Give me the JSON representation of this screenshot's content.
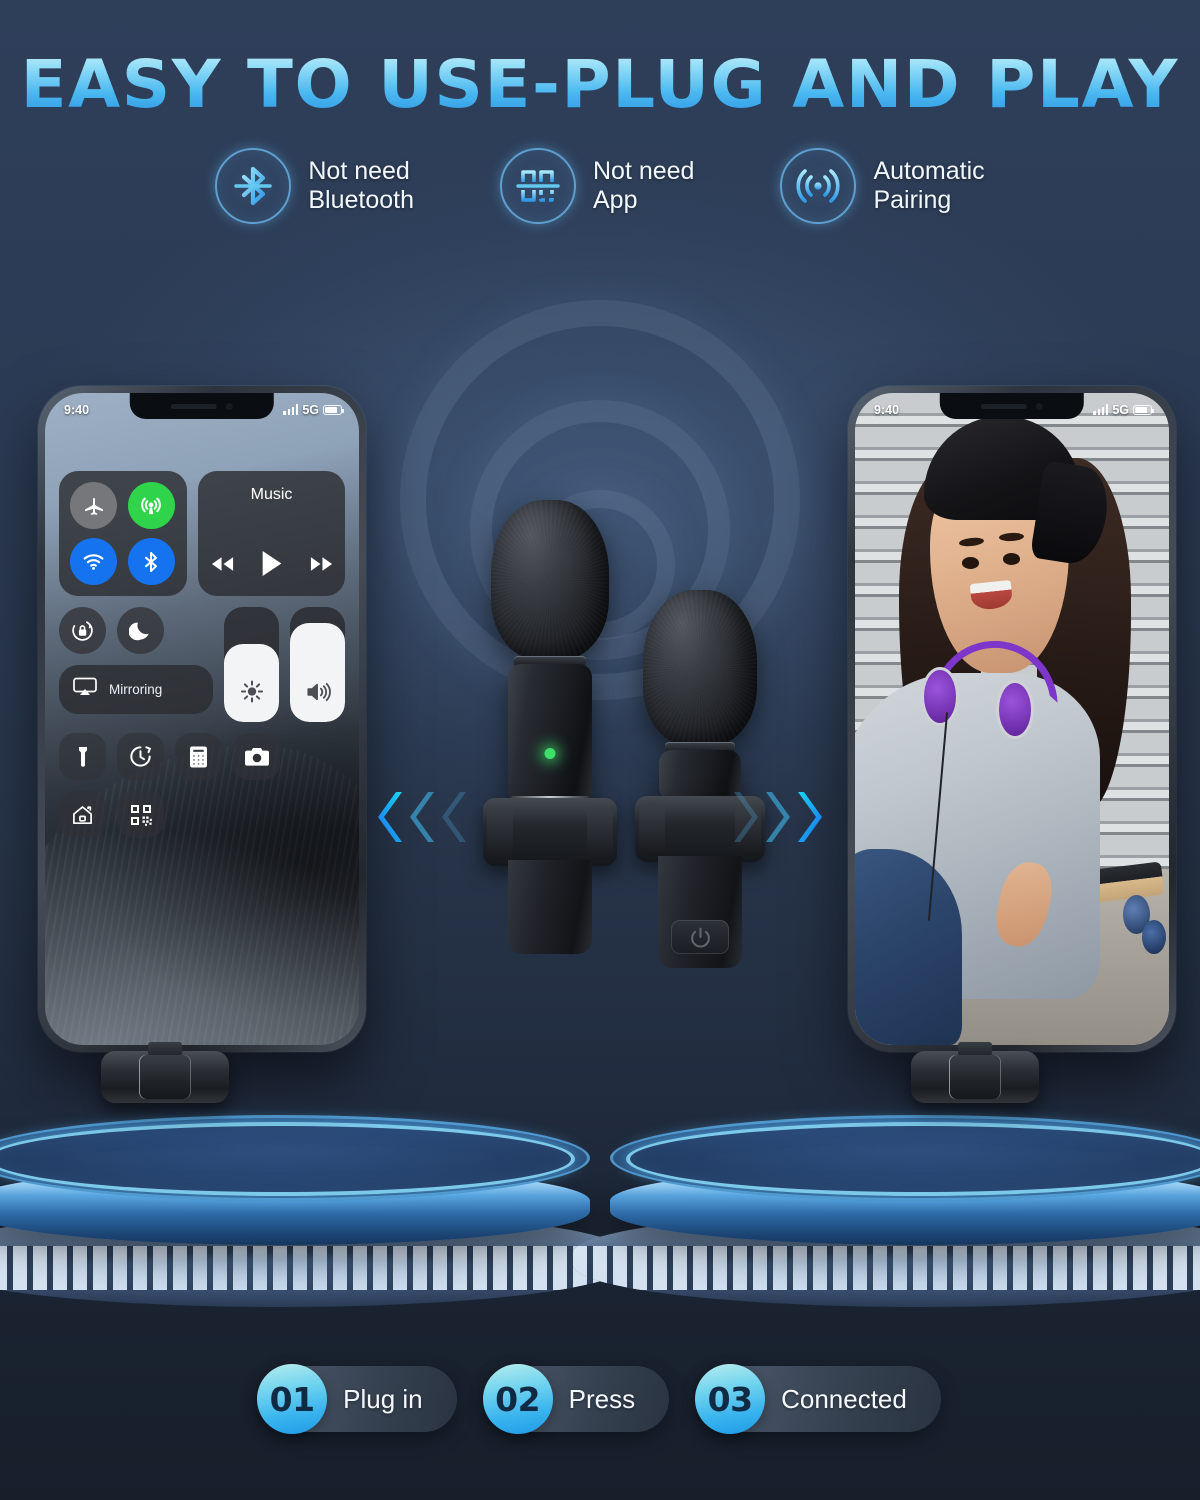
{
  "headline": "EASY TO USE-PLUG AND PLAY",
  "features": [
    {
      "icon": "bluetooth-disabled-icon",
      "label": "Not need\nBluetooth"
    },
    {
      "icon": "app-disabled-icon",
      "label": "Not need\nApp"
    },
    {
      "icon": "wireless-signal-icon",
      "label": "Automatic\nPairing"
    }
  ],
  "phones": {
    "left": {
      "name": "control-center-phone",
      "status": {
        "time": "9:40",
        "network": "5G"
      },
      "control_center": {
        "toggles": [
          {
            "icon": "airplane-mode-icon",
            "state": "off"
          },
          {
            "icon": "cellular-data-icon",
            "state": "on"
          },
          {
            "icon": "wifi-icon",
            "state": "on"
          },
          {
            "icon": "bluetooth-icon",
            "state": "on"
          }
        ],
        "music": {
          "title": "Music",
          "controls": [
            "rewind-icon",
            "play-icon",
            "fast-forward-icon"
          ]
        },
        "rotation_lock_icon": "rotation-lock-icon",
        "do_not_disturb_icon": "moon-icon",
        "mirroring": {
          "label": "Mirroring",
          "icon": "screen-mirroring-icon"
        },
        "brightness": {
          "icon": "brightness-icon",
          "value": 68
        },
        "volume": {
          "icon": "volume-icon",
          "value": 86
        },
        "shortcuts": [
          {
            "icon": "flashlight-icon"
          },
          {
            "icon": "timer-icon"
          },
          {
            "icon": "calculator-icon"
          },
          {
            "icon": "camera-icon"
          },
          {
            "icon": "home-icon"
          },
          {
            "icon": "qr-code-icon"
          }
        ]
      }
    },
    "right": {
      "name": "video-preview-phone",
      "status": {
        "time": "9:40",
        "network": "5G"
      },
      "scene": "smiling-woman-with-headphones"
    }
  },
  "product": {
    "transmitter_primary": {
      "name": "lavalier-microphone-primary",
      "led": "green-status-led"
    },
    "transmitter_secondary": {
      "name": "lavalier-microphone-secondary",
      "button": "power-button-icon"
    },
    "receiver_left": "receiver-dongle-left",
    "receiver_right": "receiver-dongle-right",
    "arrows_left": "chevron-left-icon",
    "arrows_right": "chevron-right-icon"
  },
  "steps": [
    {
      "number": "01",
      "label": "Plug in"
    },
    {
      "number": "02",
      "label": "Press"
    },
    {
      "number": "03",
      "label": "Connected"
    }
  ],
  "colors": {
    "background": "#2b3a53",
    "background_bottom": "#171f2b",
    "accent_cyan": "#57c8f2",
    "accent_blue": "#1f9ae6",
    "title_light": "#cdf2fb",
    "led_green": "#3ee06a",
    "toggle_green": "#2fd44b",
    "toggle_blue": "#1673f0",
    "step_text": "#112a44"
  }
}
